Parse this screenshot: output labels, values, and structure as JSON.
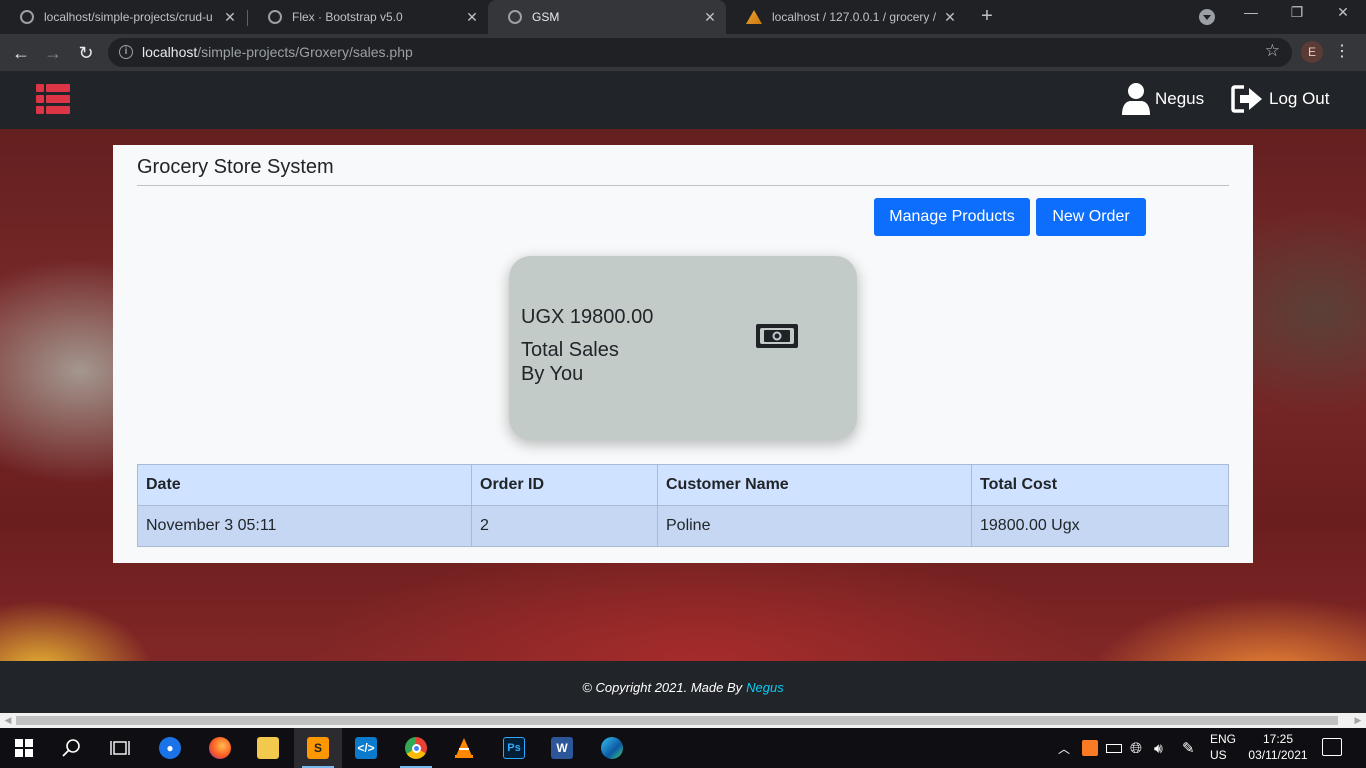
{
  "browser": {
    "tabs": [
      {
        "title": "localhost/simple-projects/crud-u",
        "active": false
      },
      {
        "title": "Flex · Bootstrap v5.0",
        "active": false
      },
      {
        "title": "GSM",
        "active": true
      },
      {
        "title": "localhost / 127.0.0.1 / grocery / s",
        "active": false
      }
    ],
    "url_host": "localhost",
    "url_path": "/simple-projects/Groxery/sales.php",
    "profile_initial": "E"
  },
  "app": {
    "user_name": "Negus",
    "logout_label": "Log Out",
    "brand_color": "#dc3545"
  },
  "card": {
    "title": "Grocery Store System",
    "buttons": {
      "manage_products": "Manage Products",
      "new_order": "New Order"
    },
    "sales_tile": {
      "amount": "UGX 19800.00",
      "label_line1": "Total Sales",
      "label_line2": "By You",
      "icon": "money-bill-icon"
    },
    "table": {
      "headers": [
        "Date",
        "Order ID",
        "Customer Name",
        "Total Cost"
      ],
      "rows": [
        [
          "November 3 05:11",
          "2",
          "Poline",
          "19800.00 Ugx"
        ]
      ]
    }
  },
  "footer": {
    "text": "© Copyright 2021. Made By",
    "author": "Negus"
  },
  "taskbar": {
    "lang_line1": "ENG",
    "lang_line2": "US",
    "time": "17:25",
    "date": "03/11/2021"
  }
}
